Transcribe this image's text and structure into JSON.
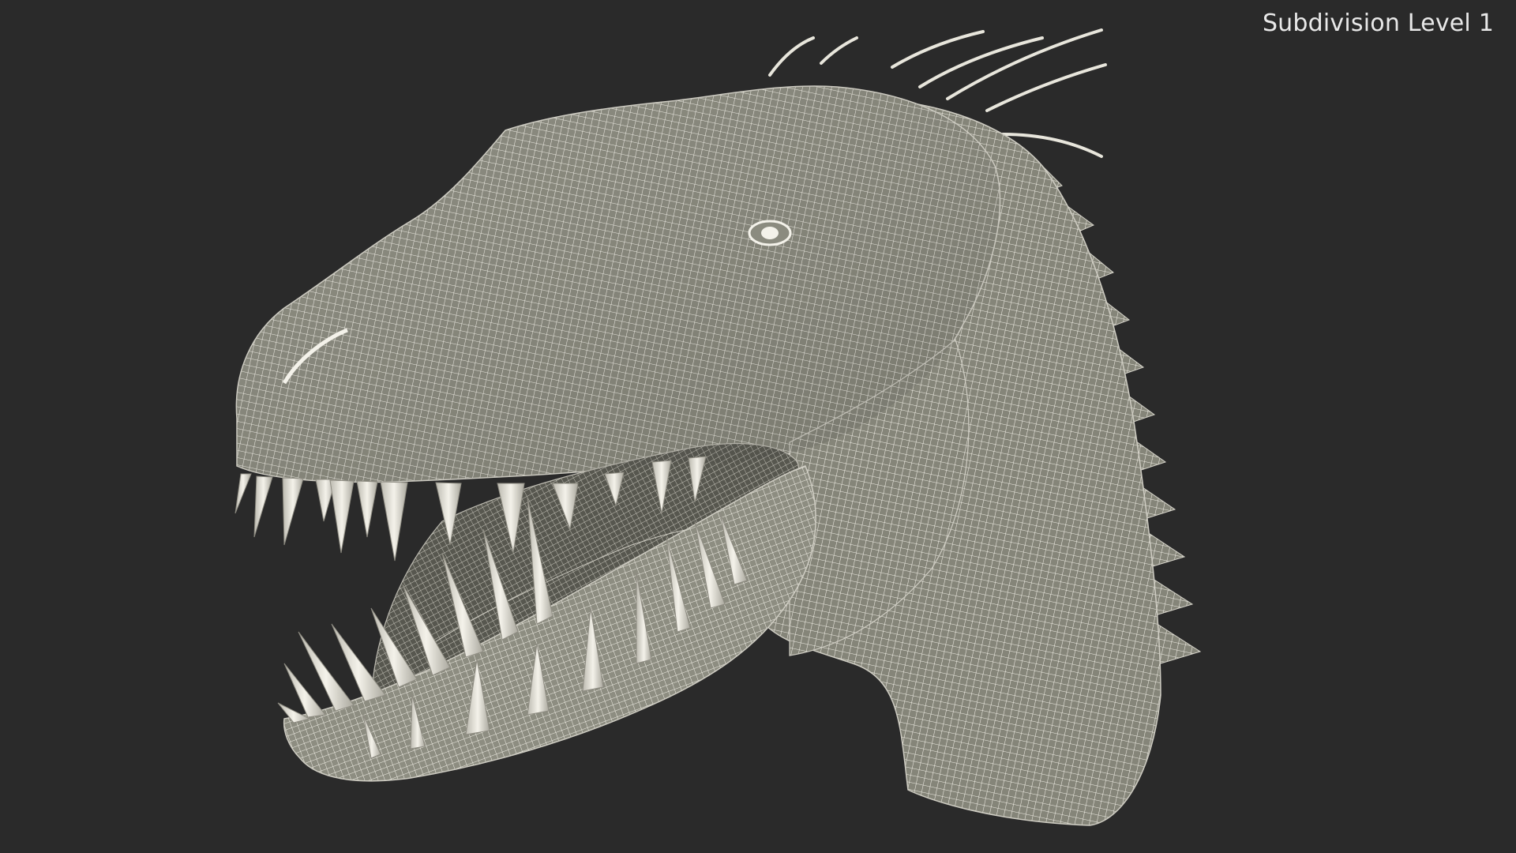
{
  "viewport": {
    "label": "Subdivision Level 1",
    "background_color": "#2a2a2a",
    "mesh_fill_color": "#8a8a7d",
    "wire_color": "#f1efe6"
  },
  "render": {
    "subject": "dinosaur-head-wireframe"
  }
}
